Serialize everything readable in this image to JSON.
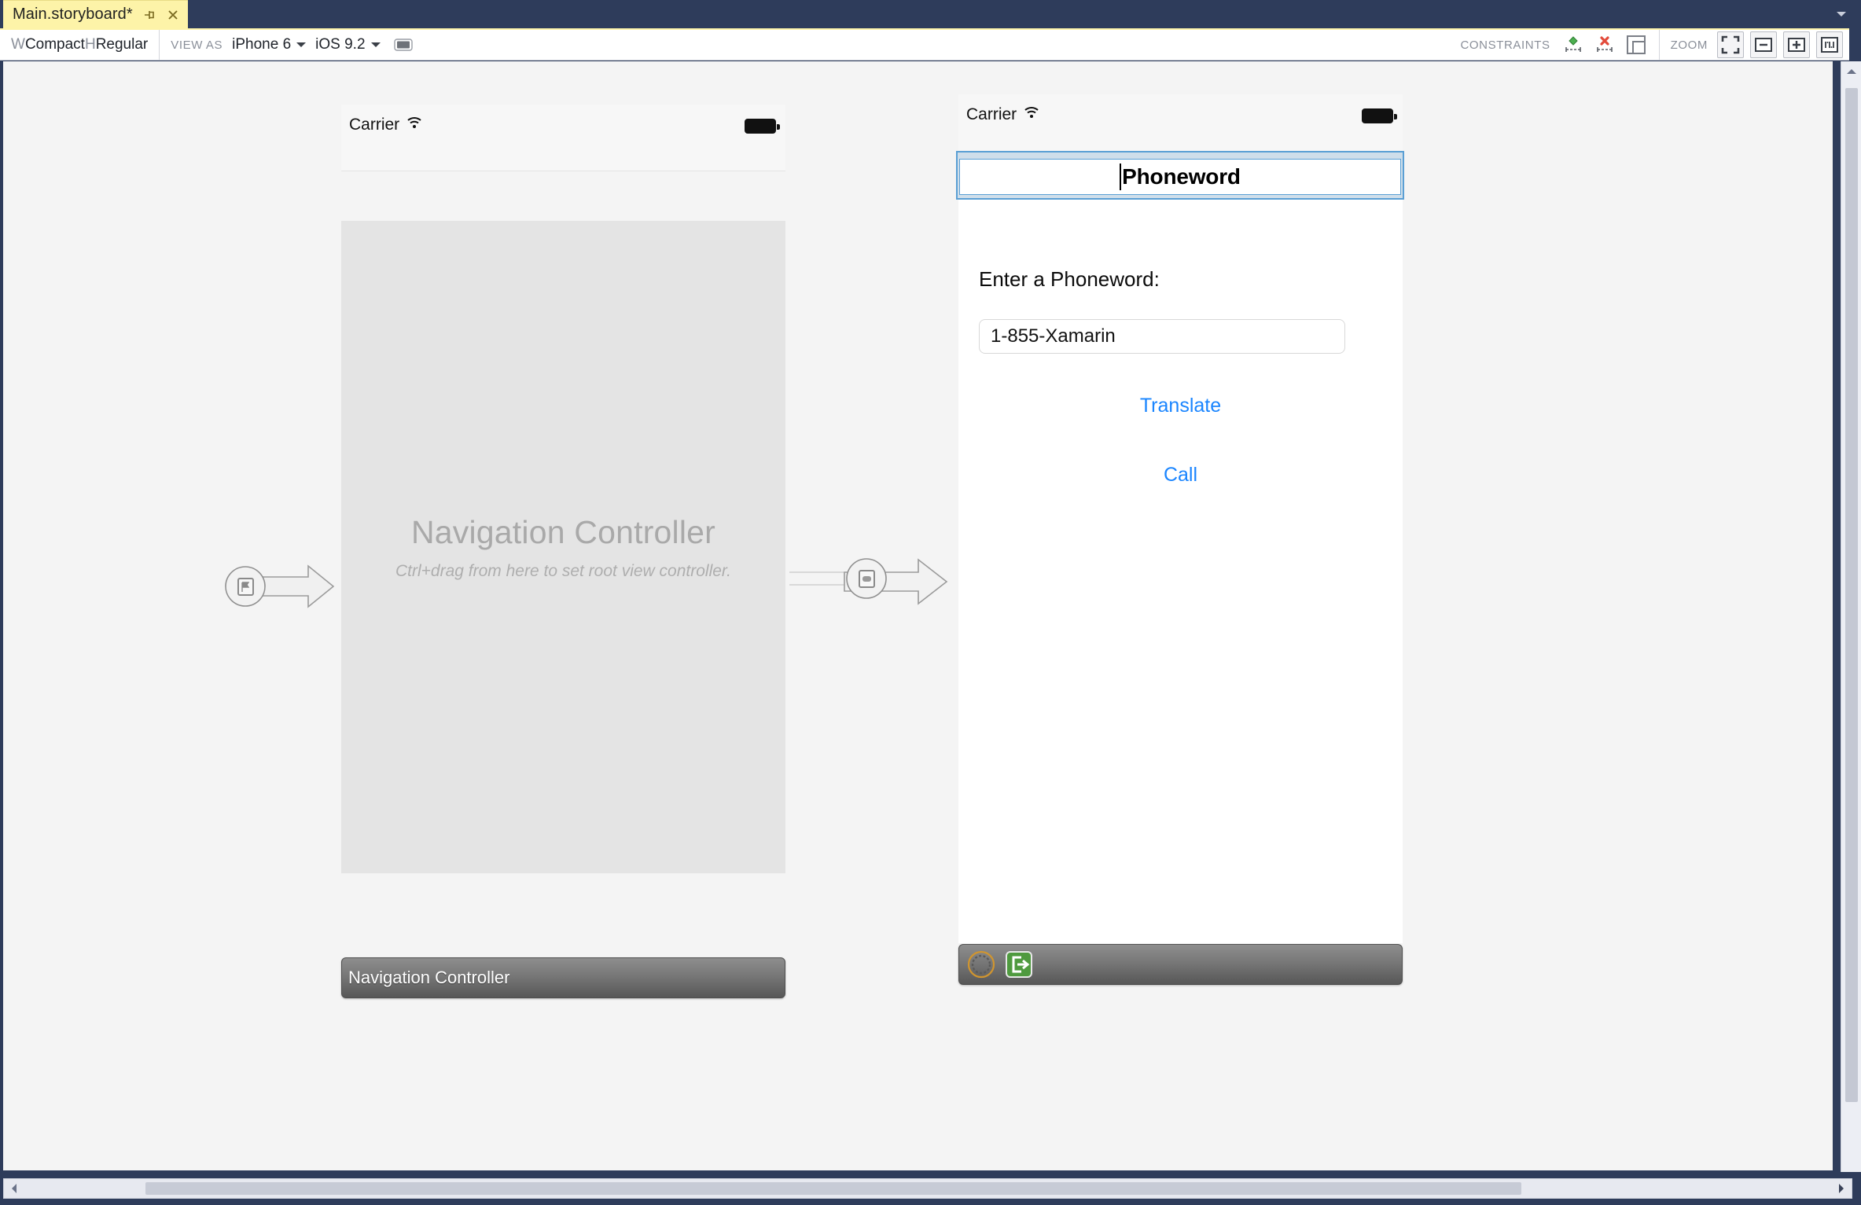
{
  "window": {
    "chrome_color": "#2e3c5b",
    "tab": {
      "label": "Main.storyboard*",
      "pin_icon": "pin-icon",
      "close_icon": "close-icon",
      "dropdown_icon": "chevron-down-icon",
      "active_color": "#fdf3a8"
    }
  },
  "toolbar": {
    "size_class": {
      "w_prefix": "W",
      "w_value": "Compact",
      "h_prefix": " H",
      "h_value": "Regular"
    },
    "view_as_label": "VIEW AS",
    "device": "iPhone 6",
    "os_version": "iOS 9.2",
    "orientation_icon": "orientation-landscape-icon",
    "constraints": {
      "label": "CONSTRAINTS",
      "add_icon": "add-constraint-icon",
      "remove_icon": "remove-constraint-icon",
      "frame_icon": "update-frames-icon"
    },
    "zoom": {
      "label": "ZOOM",
      "fit_icon": "zoom-to-fit-icon",
      "out_icon": "zoom-out-icon",
      "in_icon": "zoom-in-icon",
      "actual_icon": "zoom-actual-size-icon"
    }
  },
  "scrollbars": {
    "up_icon": "scroll-up-icon",
    "left_icon": "scroll-left-icon",
    "right_icon": "scroll-right-icon"
  },
  "canvas": {
    "background": "#f4f4f4",
    "entry_point": {
      "name": "storyboard-entry-point",
      "icon": "flag-icon"
    },
    "root_segue": {
      "name": "root-view-controller-relationship",
      "icon": "view-controller-icon"
    },
    "scenes": [
      {
        "id": "navigation-controller",
        "statusbar": {
          "carrier": "Carrier",
          "wifi_icon": "wifi-icon",
          "battery_icon": "battery-icon"
        },
        "title": "Navigation Controller",
        "subtitle": "Ctrl+drag from here to set root view controller.",
        "dock_label": "Navigation Controller",
        "body_color": "#e4e4e4"
      },
      {
        "id": "phoneword",
        "statusbar": {
          "carrier": "Carrier",
          "wifi_icon": "wifi-icon",
          "battery_icon": "battery-icon"
        },
        "navbar_title": "Phoneword",
        "navbar_state": "editing",
        "selection_color": "#5a9fd4",
        "label": "Enter a Phoneword:",
        "textfield_value": "1-855-Xamarin",
        "textfield_placeholder": "",
        "buttons": [
          {
            "label": "Translate",
            "color": "#1a85ff"
          },
          {
            "label": "Call",
            "color": "#1a85ff"
          }
        ],
        "dock_icons": [
          {
            "name": "view-controller-dock-icon"
          },
          {
            "name": "exit-segue-icon"
          }
        ]
      }
    ]
  }
}
